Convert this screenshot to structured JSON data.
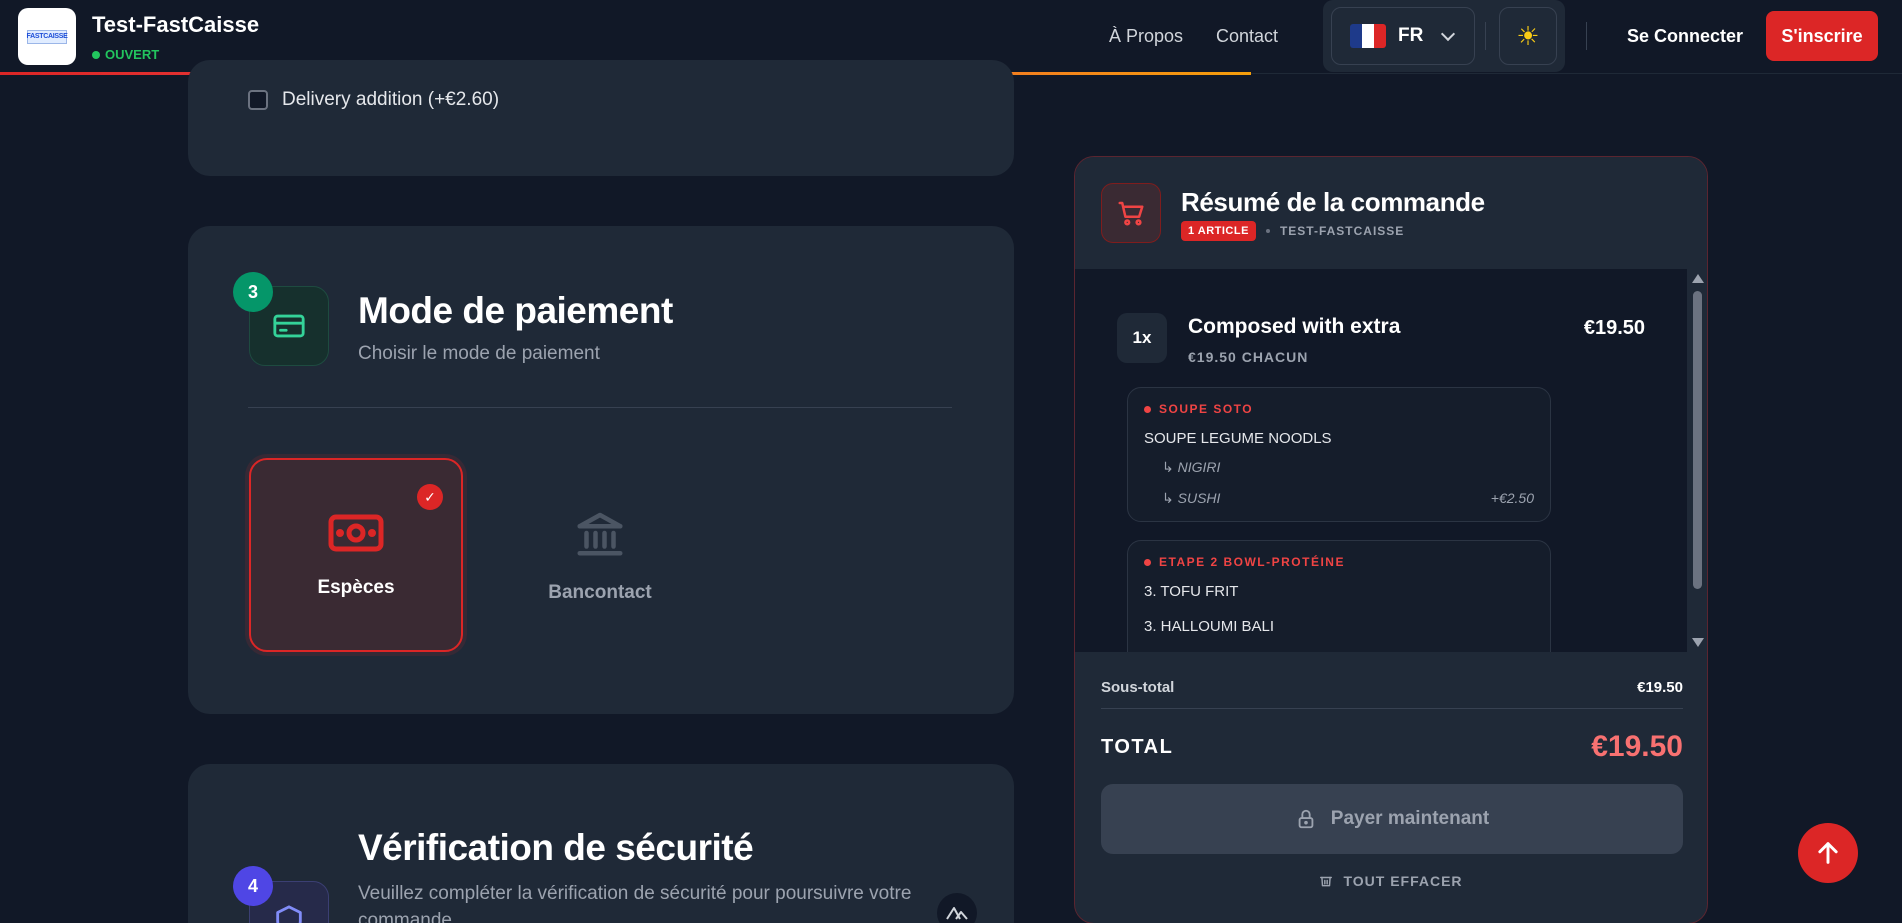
{
  "header": {
    "store_name": "Test-FastCaisse",
    "status": "OUVERT",
    "logo_text": "FASTCAISSE",
    "nav": {
      "about": "À Propos",
      "contact": "Contact"
    },
    "language": {
      "code": "FR",
      "flag": [
        "#1e3a8a",
        "#ffffff",
        "#dc2626"
      ]
    },
    "theme_icon": "☀",
    "login": "Se Connecter",
    "signup": "S'inscrire"
  },
  "options_card": {
    "delivery_label": "Delivery addition (+€2.60)",
    "delivery_checked": false
  },
  "payment": {
    "step": "3",
    "title": "Mode de paiement",
    "subtitle": "Choisir le mode de paiement",
    "options": [
      {
        "label": "Espèces",
        "icon": "banknote-icon",
        "selected": true
      },
      {
        "label": "Bancontact",
        "icon": "bank-icon",
        "selected": false
      }
    ]
  },
  "security": {
    "step": "4",
    "title": "Vérification de sécurité",
    "subtitle": "Veuillez compléter la vérification de sécurité pour poursuivre votre commande"
  },
  "summary": {
    "title": "Résumé de la commande",
    "article_badge": "1 ARTICLE",
    "store": "TEST-FASTCAISSE",
    "item": {
      "qty": "1x",
      "name": "Composed with extra",
      "each": "€19.50 CHACUN",
      "price": "€19.50"
    },
    "groups": [
      {
        "heading": "SOUPE SOTO",
        "main": [
          "SOUPE LEGUME NOODLS"
        ],
        "subs": [
          {
            "label": "↳ NIGIRI",
            "price": ""
          },
          {
            "label": "↳ SUSHI",
            "price": "+€2.50"
          }
        ]
      },
      {
        "heading": "ETAPE 2 BOWL-PROTÉINE",
        "main": [
          "3. TOFU FRIT",
          "3. HALLOUMI BALI"
        ],
        "subs": []
      }
    ],
    "subtotal_label": "Sous-total",
    "subtotal_value": "€19.50",
    "total_label": "TOTAL",
    "total_value": "€19.50",
    "pay_button": "Payer maintenant",
    "clear_all": "TOUT EFFACER"
  },
  "colors": {
    "accent": "#dc2626",
    "open_status": "#22c55e",
    "step3": "#059669",
    "step4": "#4f46e5"
  }
}
